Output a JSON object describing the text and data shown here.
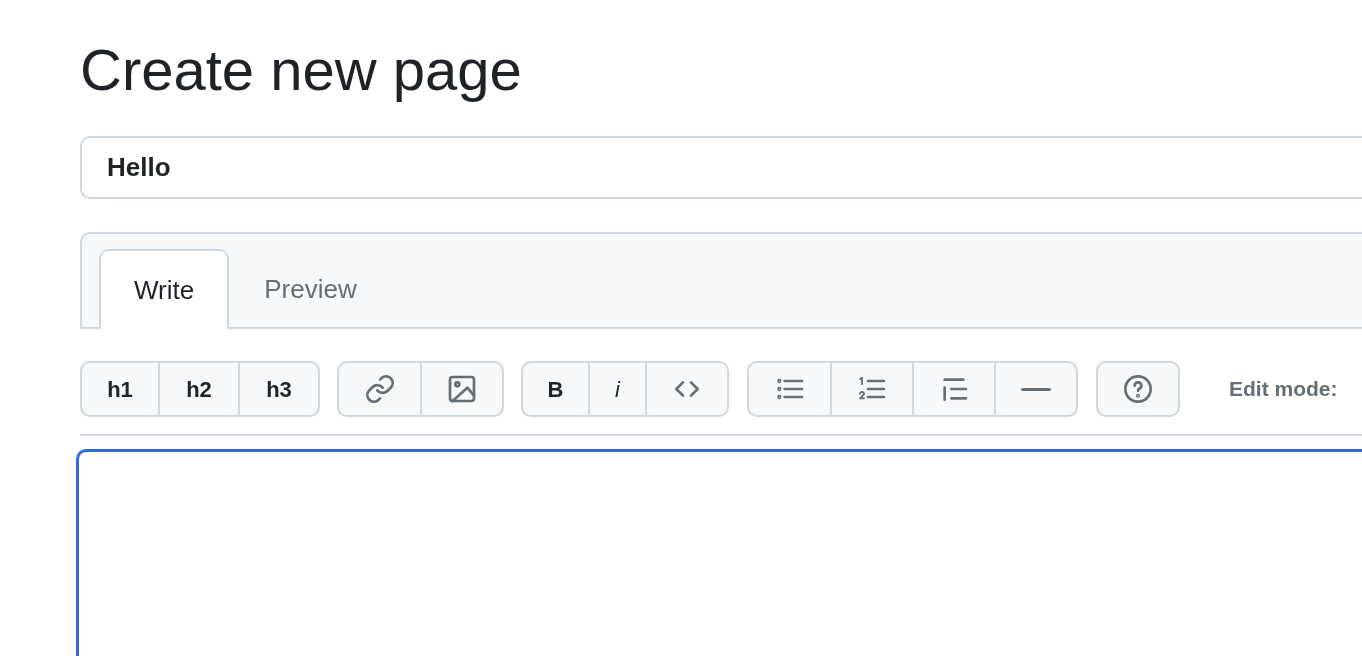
{
  "title": "Create new page",
  "page_title_field": {
    "value": "Hello"
  },
  "tabs": [
    {
      "label": "Write",
      "selected": true
    },
    {
      "label": "Preview",
      "selected": false
    }
  ],
  "heading_buttons": [
    "h1",
    "h2",
    "h3"
  ],
  "format_buttons": [
    "B",
    "i"
  ],
  "edit_mode_label": "Edit mode:"
}
